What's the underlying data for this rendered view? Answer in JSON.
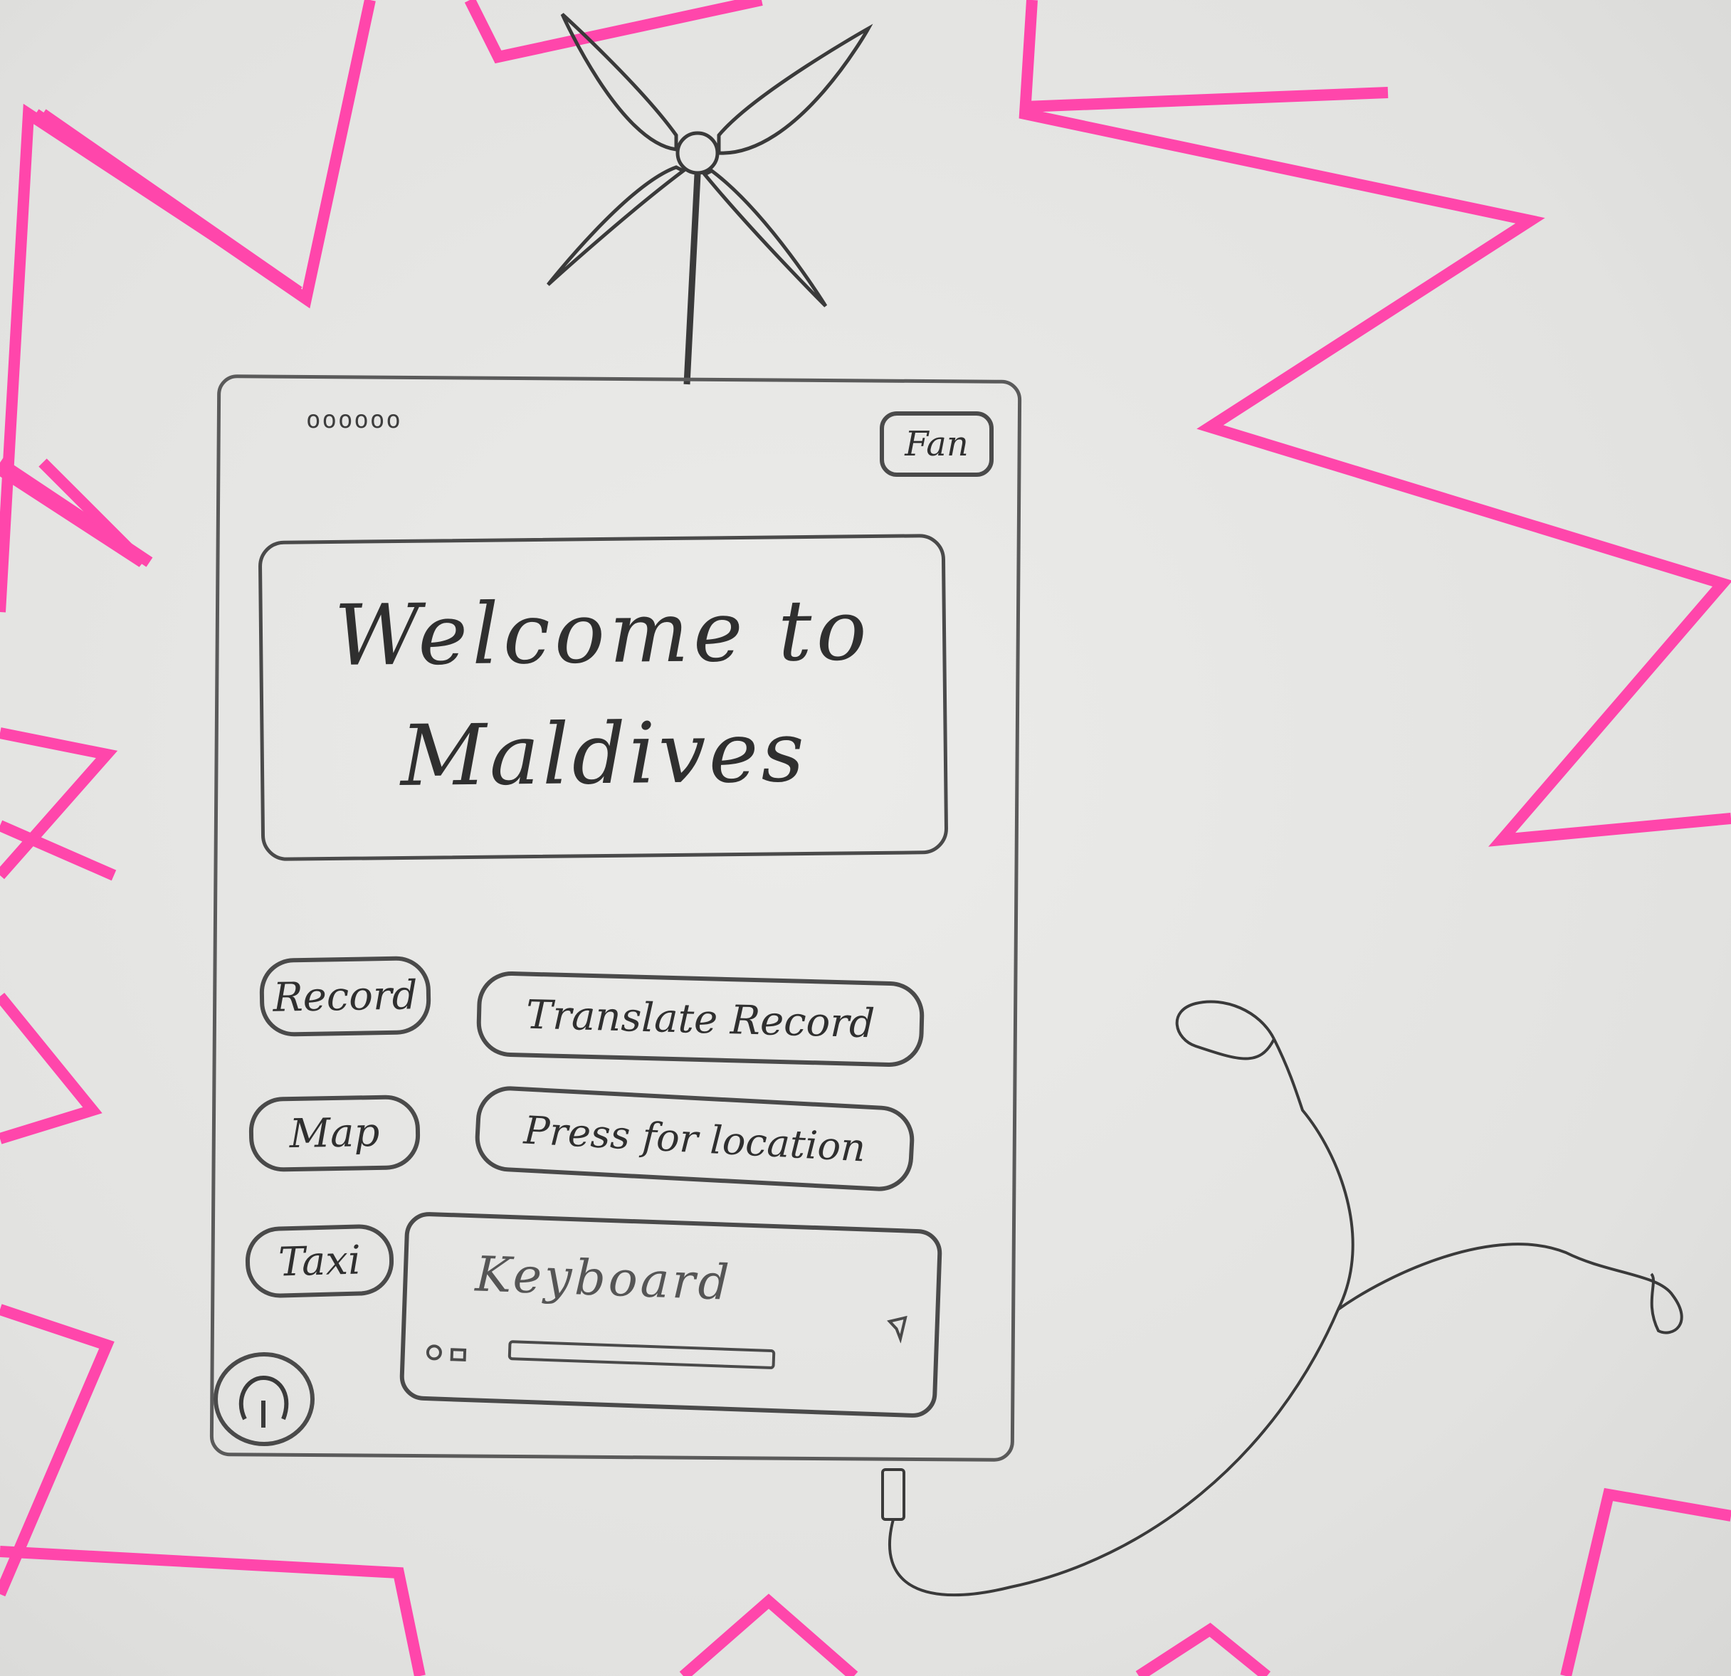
{
  "app": {
    "status_dots": "oooooo",
    "fan_label": "Fan",
    "welcome_line1": "Welcome to",
    "welcome_line2": "Maldives"
  },
  "actions": {
    "record_label": "Record",
    "translate_label": "Translate Record",
    "map_label": "Map",
    "location_label": "Press for location",
    "taxi_label": "Taxi"
  },
  "keyboard": {
    "placeholder": "Keyboard"
  },
  "icons": {
    "fan": "fan-icon",
    "power": "power-icon",
    "send": "send-icon",
    "mic": "mic-icon",
    "camera": "camera-icon",
    "earphones": "earphones-icon"
  },
  "colors": {
    "highlight": "#ff3fa8",
    "pencil": "#4a4a4a",
    "paper": "#e4e4e2"
  }
}
